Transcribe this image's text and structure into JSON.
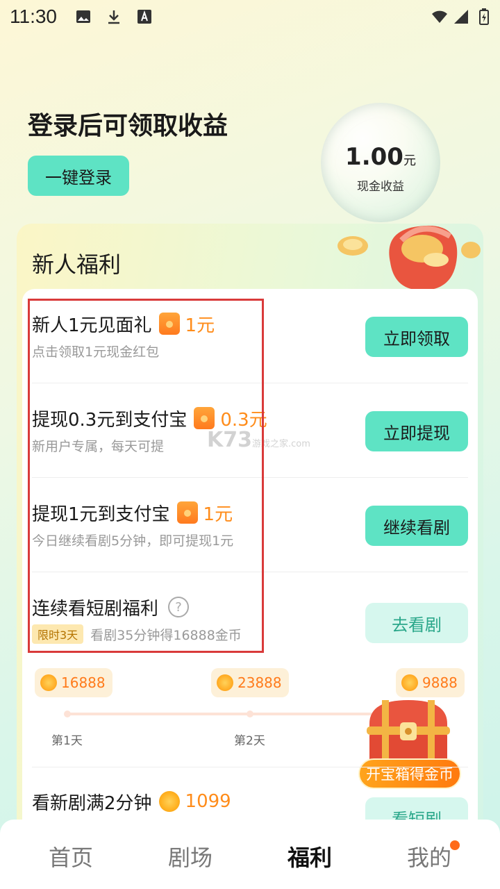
{
  "status_bar": {
    "time": "11:30"
  },
  "header": {
    "title": "登录后可领取收益",
    "login_label": "一键登录",
    "cash_amount": "1.00",
    "cash_unit": "元",
    "cash_label": "现金收益"
  },
  "welfare": {
    "title": "新人福利",
    "tasks": [
      {
        "title": "新人1元见面礼",
        "reward": "1元",
        "sub": "点击领取1元现金红包",
        "button": "立即领取"
      },
      {
        "title": "提现0.3元到支付宝",
        "reward": "0.3元",
        "sub": "新用户专属，每天可提",
        "button": "立即提现"
      },
      {
        "title": "提现1元到支付宝",
        "reward": "1元",
        "sub": "今日继续看剧5分钟，即可提现1元",
        "button": "继续看剧"
      },
      {
        "title": "连续看短剧福利",
        "tag": "限时3天",
        "sub": "看剧35分钟得16888金币",
        "button": "去看剧"
      },
      {
        "title": "看新剧满2分钟",
        "reward": "1099",
        "button": "看短剧"
      }
    ],
    "streak": [
      {
        "coins": "16888",
        "day": "第1天"
      },
      {
        "coins": "23888",
        "day": "第2天"
      },
      {
        "coins": "9888"
      }
    ],
    "chest_label": "开宝箱得金币"
  },
  "watermark": {
    "brand": "K73",
    "site": "游戏之家",
    "domain": ".com"
  },
  "tabs": [
    {
      "label": "首页"
    },
    {
      "label": "剧场"
    },
    {
      "label": "福利"
    },
    {
      "label": "我的"
    }
  ],
  "colors": {
    "accent": "#5ee3c4",
    "reward": "#ff8c1a",
    "highlight": "#d93a3a"
  }
}
